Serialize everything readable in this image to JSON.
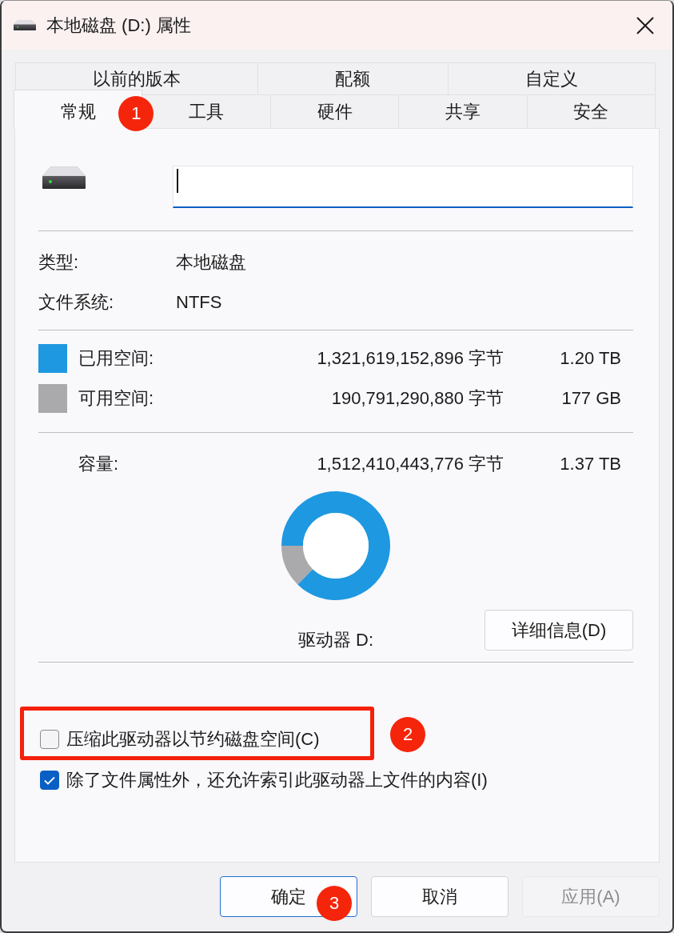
{
  "window": {
    "title": "本地磁盘 (D:) 属性"
  },
  "tab_rows": [
    {
      "tabs": [
        {
          "label": "以前的版本",
          "selected": false
        },
        {
          "label": "配额",
          "selected": false
        },
        {
          "label": "自定义",
          "selected": false
        }
      ]
    },
    {
      "tabs": [
        {
          "label": "常规",
          "selected": true,
          "marker": "1"
        },
        {
          "label": "工具",
          "selected": false
        },
        {
          "label": "硬件",
          "selected": false
        },
        {
          "label": "共享",
          "selected": false
        },
        {
          "label": "安全",
          "selected": false
        }
      ]
    }
  ],
  "general": {
    "name_field": {
      "focused": true
    },
    "info": [
      {
        "label": "类型:",
        "value": "本地磁盘"
      },
      {
        "label": "文件系统:",
        "value": "NTFS"
      }
    ],
    "usage": [
      {
        "label": "已用空间:",
        "bytes": "1,321,619,152,896 字节",
        "size": "1.20 TB",
        "color": "#1e98e0"
      },
      {
        "label": "可用空间:",
        "bytes": "190,791,290,880 字节",
        "size": "177 GB",
        "color": "#aaa9ac"
      }
    ],
    "capacity": {
      "label": "容量:",
      "bytes": "1,512,410,443,776 字节",
      "size": "1.37 TB"
    },
    "chart_data": {
      "type": "donut",
      "values": [
        87.4,
        12.6
      ]
    },
    "drive_label": "驱动器 D:",
    "details_button": "详细信息(D)",
    "options": [
      {
        "label": "压缩此驱动器以节约磁盘空间(C)",
        "checked": false,
        "highlighted": true,
        "marker": "2"
      },
      {
        "label": "除了文件属性外，还允许索引此驱动器上文件的内容(I)",
        "checked": true,
        "highlighted": false
      }
    ]
  },
  "buttons": [
    {
      "label": "确定",
      "default": true,
      "disabled": false,
      "marker": "3"
    },
    {
      "label": "取消",
      "default": false,
      "disabled": false
    },
    {
      "label": "应用(A)",
      "default": false,
      "disabled": true
    }
  ]
}
